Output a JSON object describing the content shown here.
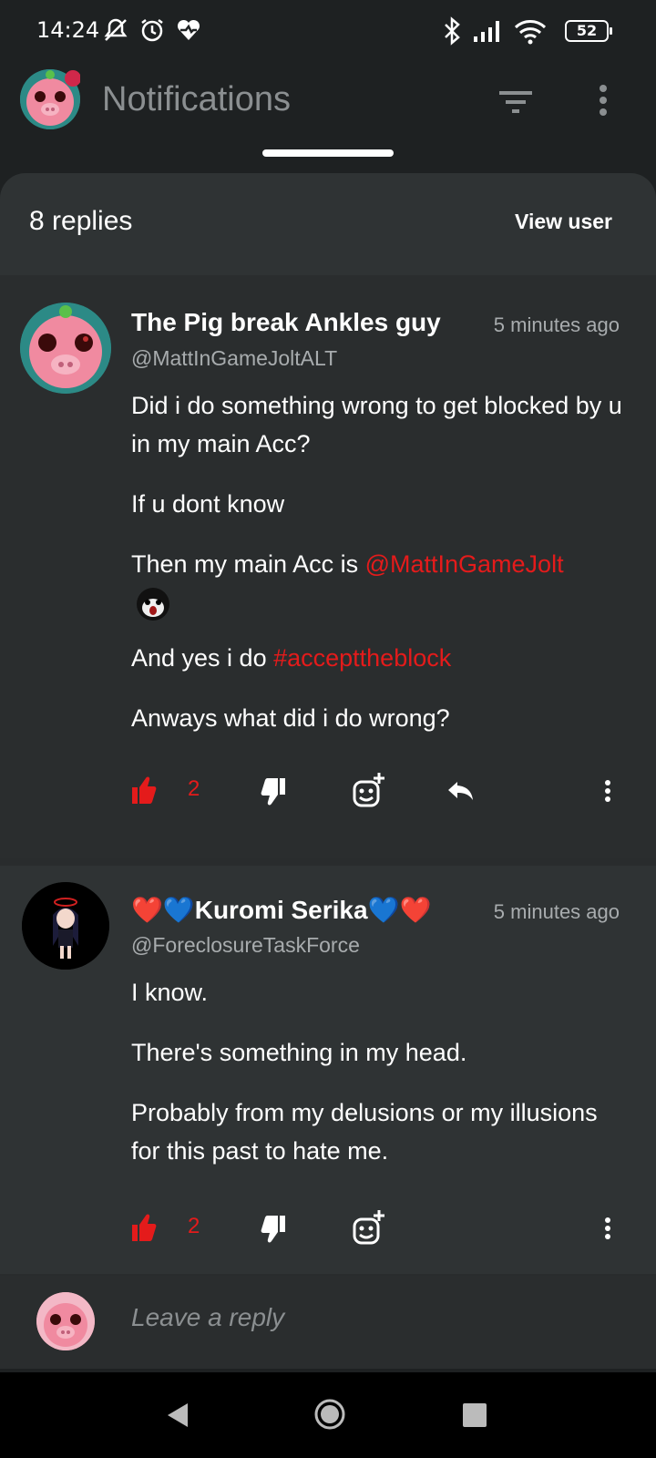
{
  "status_bar": {
    "time": "14:24",
    "battery": "52",
    "icons_left": [
      "muted-icon",
      "alarm-icon",
      "heartbeat-icon"
    ],
    "icons_right": [
      "bluetooth-icon",
      "signal-icon",
      "wifi-icon",
      "battery-icon"
    ]
  },
  "header": {
    "title": "Notifications",
    "icons": [
      "filter-icon",
      "more-icon"
    ]
  },
  "sheet": {
    "replies_label": "8 replies",
    "view_user_label": "View user"
  },
  "comments": [
    {
      "name": "The Pig break Ankles guy",
      "handle": "@MattInGameJoltALT",
      "time": "5 minutes ago",
      "paragraphs": {
        "p1": "Did i do something wrong to get blocked by u in my main Acc?",
        "p2": "If u dont know",
        "p3_prefix": "Then my main Acc is ",
        "p3_mention": "@MattInGameJolt",
        "p4_prefix": "And yes i do ",
        "p4_hashtag": "#accepttheblock",
        "p5": "Anways what did i do wrong?"
      },
      "likes": "2"
    },
    {
      "name": "❤️💙Kuromi Serika💙❤️",
      "handle": "@ForeclosureTaskForce",
      "time": "5 minutes ago",
      "paragraphs": {
        "p1": "I know.",
        "p2": "There's something in my head.",
        "p3": "Probably from my delusions or my illusions for this past to hate me."
      },
      "likes": "2"
    }
  ],
  "reply_bar": {
    "placeholder": "Leave a reply"
  },
  "colors": {
    "accent_red": "#e41b1b",
    "background": "#1e2122",
    "card": "#2a2d2e"
  }
}
